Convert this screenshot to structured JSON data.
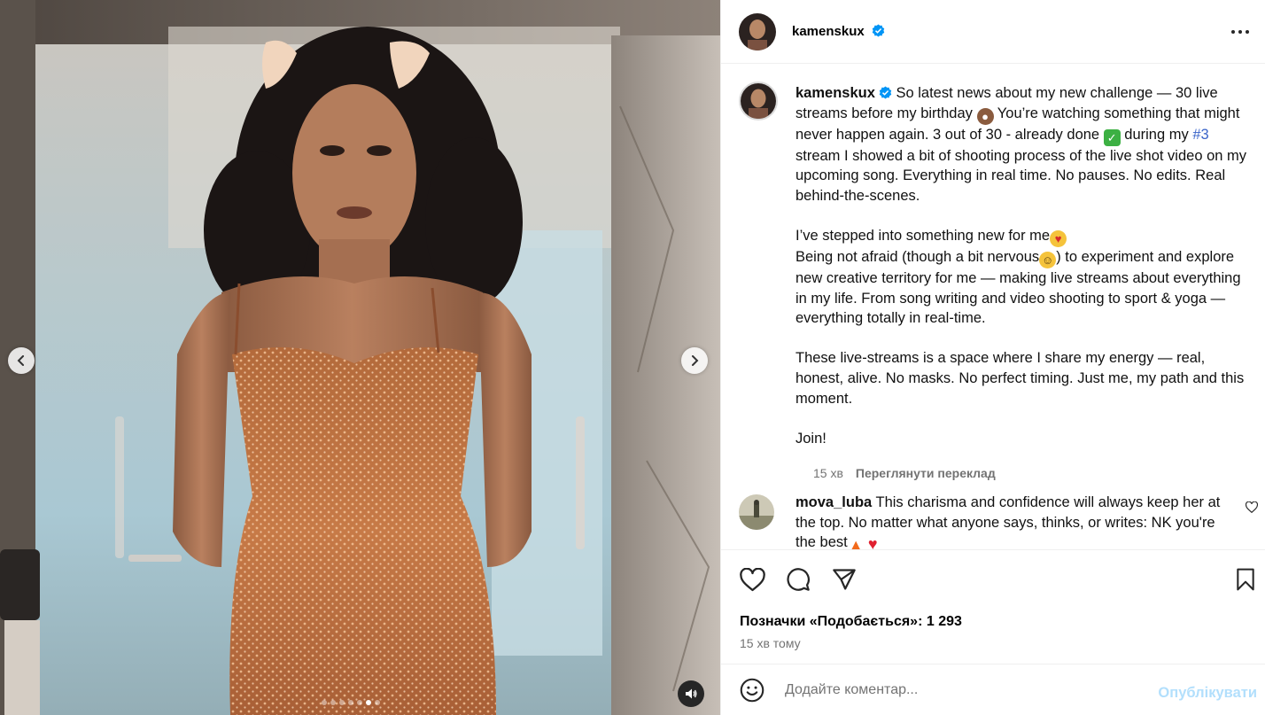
{
  "post": {
    "username": "kamenskux",
    "verified": true,
    "media": {
      "slide_count": 7,
      "active_slide": 5,
      "prev_icon": "chevron-left-icon",
      "next_icon": "chevron-right-icon",
      "audio_icon": "speaker-icon"
    }
  },
  "caption": {
    "username": "kamenskux",
    "p1a": " So latest news about my new challenge — 30 live streams before my birthday ",
    "p1b": " You’re watching something that might never happen again. 3 out of 30 - already done ",
    "p1c": " during my ",
    "hashtag": "#3",
    "p1d": " stream I showed a bit of shooting process of the live shot video on my upcoming song. Everything in real time. No pauses. No edits. Real behind-the-scenes.\n\nI’ve stepped into something new for me",
    "p2a": "\nBeing not afraid (though a bit nervous",
    "p2b": ") to experiment and explore new creative territory for me — making live streams about everything in my life. From song writing and video shooting to sport & yoga — everything totally in real-time.\n\nThese live-streams is a space where I share my energy — real, honest, alive. No masks. No perfect timing. Just me, my path and this moment.\n\nJoin!",
    "time": "15 хв",
    "translate_label": "Переглянути переклад"
  },
  "comment": {
    "username": "mova_luba",
    "text_a": " This charisma and confidence will always keep her at the top. No matter what anyone says, thinks, or writes: NK you're the best"
  },
  "actions": {
    "like_icon": "heart-icon",
    "comment_icon": "comment-bubble-icon",
    "share_icon": "send-icon",
    "save_icon": "bookmark-icon",
    "likes_label": "Позначки «Подобається»: 1 293",
    "time_ago": "15 хв тому"
  },
  "composer": {
    "placeholder": "Додайте коментар...",
    "publish_label": "Опублікувати",
    "emoji_icon": "smiley-icon"
  },
  "colors": {
    "verified": "#0095f6",
    "link": "#3a64c9",
    "publish_disabled": "#b2dffc",
    "muted_text": "#737373"
  }
}
